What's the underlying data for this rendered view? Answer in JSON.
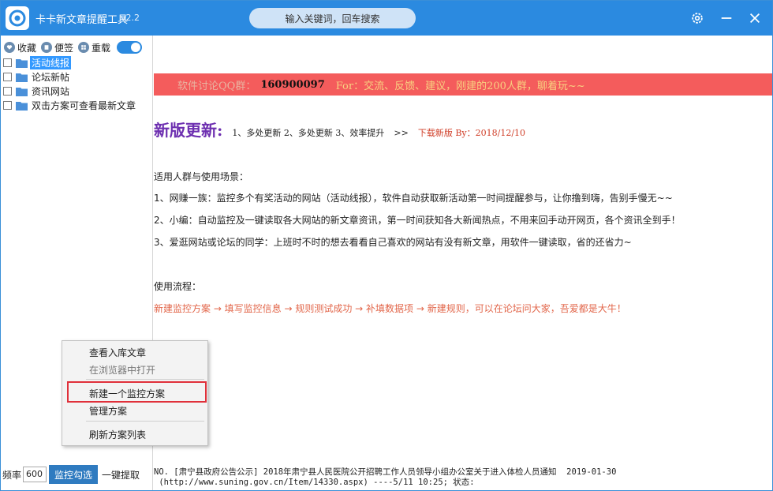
{
  "app": {
    "title": "卡卡新文章提醒工具",
    "version": "v2.2"
  },
  "search": {
    "placeholder": "输入关键词，回车搜索"
  },
  "toolbar": {
    "favorites": "收藏",
    "notes": "便签",
    "reload": "重载",
    "toggle_on": true
  },
  "tree": {
    "items": [
      {
        "label": "活动线报",
        "selected": true
      },
      {
        "label": "论坛新帖",
        "selected": false
      },
      {
        "label": "资讯网站",
        "selected": false
      },
      {
        "label": "双击方案可查看最新文章",
        "selected": false
      }
    ]
  },
  "bottom": {
    "freq_label": "频率",
    "freq_value": "600",
    "monitor_label": "监控勾选",
    "extract_label": "一键提取"
  },
  "banner": {
    "part1": "软件讨论QQ群：",
    "qq": "160900097",
    "part2": "For：交流、反馈、建议，刚建的200人群，聊着玩~~"
  },
  "update": {
    "title": "新版更新:",
    "items": "1、多处更新 2、多处更新 3、效率提升",
    "arrow": ">>",
    "link": "下载新版 By：2018/12/10"
  },
  "intro": {
    "heading": "适用人群与使用场景：",
    "line1": "1、网赚一族：监控多个有奖活动的网站（活动线报），软件自动获取新活动第一时间提醒参与，让你撸到嗨，告别手慢无~~",
    "line2": "2、小编：自动监控及一键读取各大网站的新文章资讯，第一时间获知各大新闻热点，不用来回手动开网页，各个资讯全到手！",
    "line3": "3、爱逛网站或论坛的同学：上班时不时的想去看看自己喜欢的网站有没有新文章，用软件一键读取，省的还省力~"
  },
  "flow": {
    "heading": "使用流程：",
    "steps": "新建监控方案 → 填写监控信息 → 规则测试成功 → 补填数据项 → 新建规则，可以在论坛问大家，吾爱都是大牛！"
  },
  "status": {
    "line1": "NO. [肃宁县政府公告公示] 2018年肃宁县人民医院公开招聘工作人员领导小组办公室关于进入体检人员通知  2019-01-30",
    "line2": " (http://www.suning.gov.cn/Item/14330.aspx) ----5/11 10:25; 状态:"
  },
  "context_menu": {
    "items": [
      {
        "label": "查看入库文章",
        "enabled": true
      },
      {
        "label": "在浏览器中打开",
        "enabled": false
      },
      {
        "label": "新建一个监控方案",
        "enabled": true,
        "highlighted": true
      },
      {
        "label": "管理方案",
        "enabled": true
      },
      {
        "label": "刷新方案列表",
        "enabled": true
      }
    ]
  },
  "colors": {
    "titlebar": "#2b8ae0",
    "banner": "#f45c5c",
    "update_title": "#6d2fb0",
    "flow": "#e2664a",
    "highlight": "#e0303a"
  }
}
